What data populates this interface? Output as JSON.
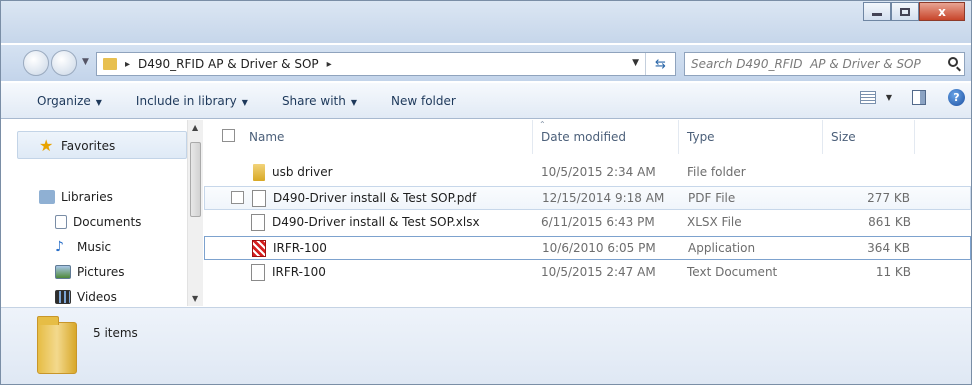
{
  "window": {
    "caption_close": "x"
  },
  "address": {
    "crumb": "D490_RFID  AP & Driver & SOP",
    "crumb_arrow": "▸",
    "search_placeholder": "Search D490_RFID  AP & Driver & SOP"
  },
  "toolbar": {
    "organize": "Organize",
    "include": "Include in library",
    "share": "Share with",
    "new_folder": "New folder",
    "dropdown_glyph": "▼"
  },
  "nav": {
    "favorites": "Favorites",
    "libraries": "Libraries",
    "documents": "Documents",
    "music": "Music",
    "pictures": "Pictures",
    "videos": "Videos"
  },
  "columns": {
    "name": "Name",
    "date": "Date modified",
    "type": "Type",
    "size": "Size"
  },
  "files": [
    {
      "name": "usb driver",
      "date": "10/5/2015 2:34 AM",
      "type": "File folder",
      "size": "",
      "icon": "folder-icon"
    },
    {
      "name": "D490-Driver install & Test SOP.pdf",
      "date": "12/15/2014 9:18 AM",
      "type": "PDF File",
      "size": "277 KB",
      "icon": "pdf-file-icon"
    },
    {
      "name": "D490-Driver install & Test SOP.xlsx",
      "date": "6/11/2015 6:43 PM",
      "type": "XLSX File",
      "size": "861 KB",
      "icon": "xlsx-file-icon"
    },
    {
      "name": "IRFR-100",
      "date": "10/6/2010 6:05 PM",
      "type": "Application",
      "size": "364 KB",
      "icon": "application-icon"
    },
    {
      "name": "IRFR-100",
      "date": "10/5/2015 2:47 AM",
      "type": "Text Document",
      "size": "11 KB",
      "icon": "text-file-icon"
    }
  ],
  "status": {
    "count": "5 items"
  },
  "colors": {
    "folder": "#e6bd45",
    "accent": "#1e395b",
    "hover_border": "#c7d7ea"
  }
}
